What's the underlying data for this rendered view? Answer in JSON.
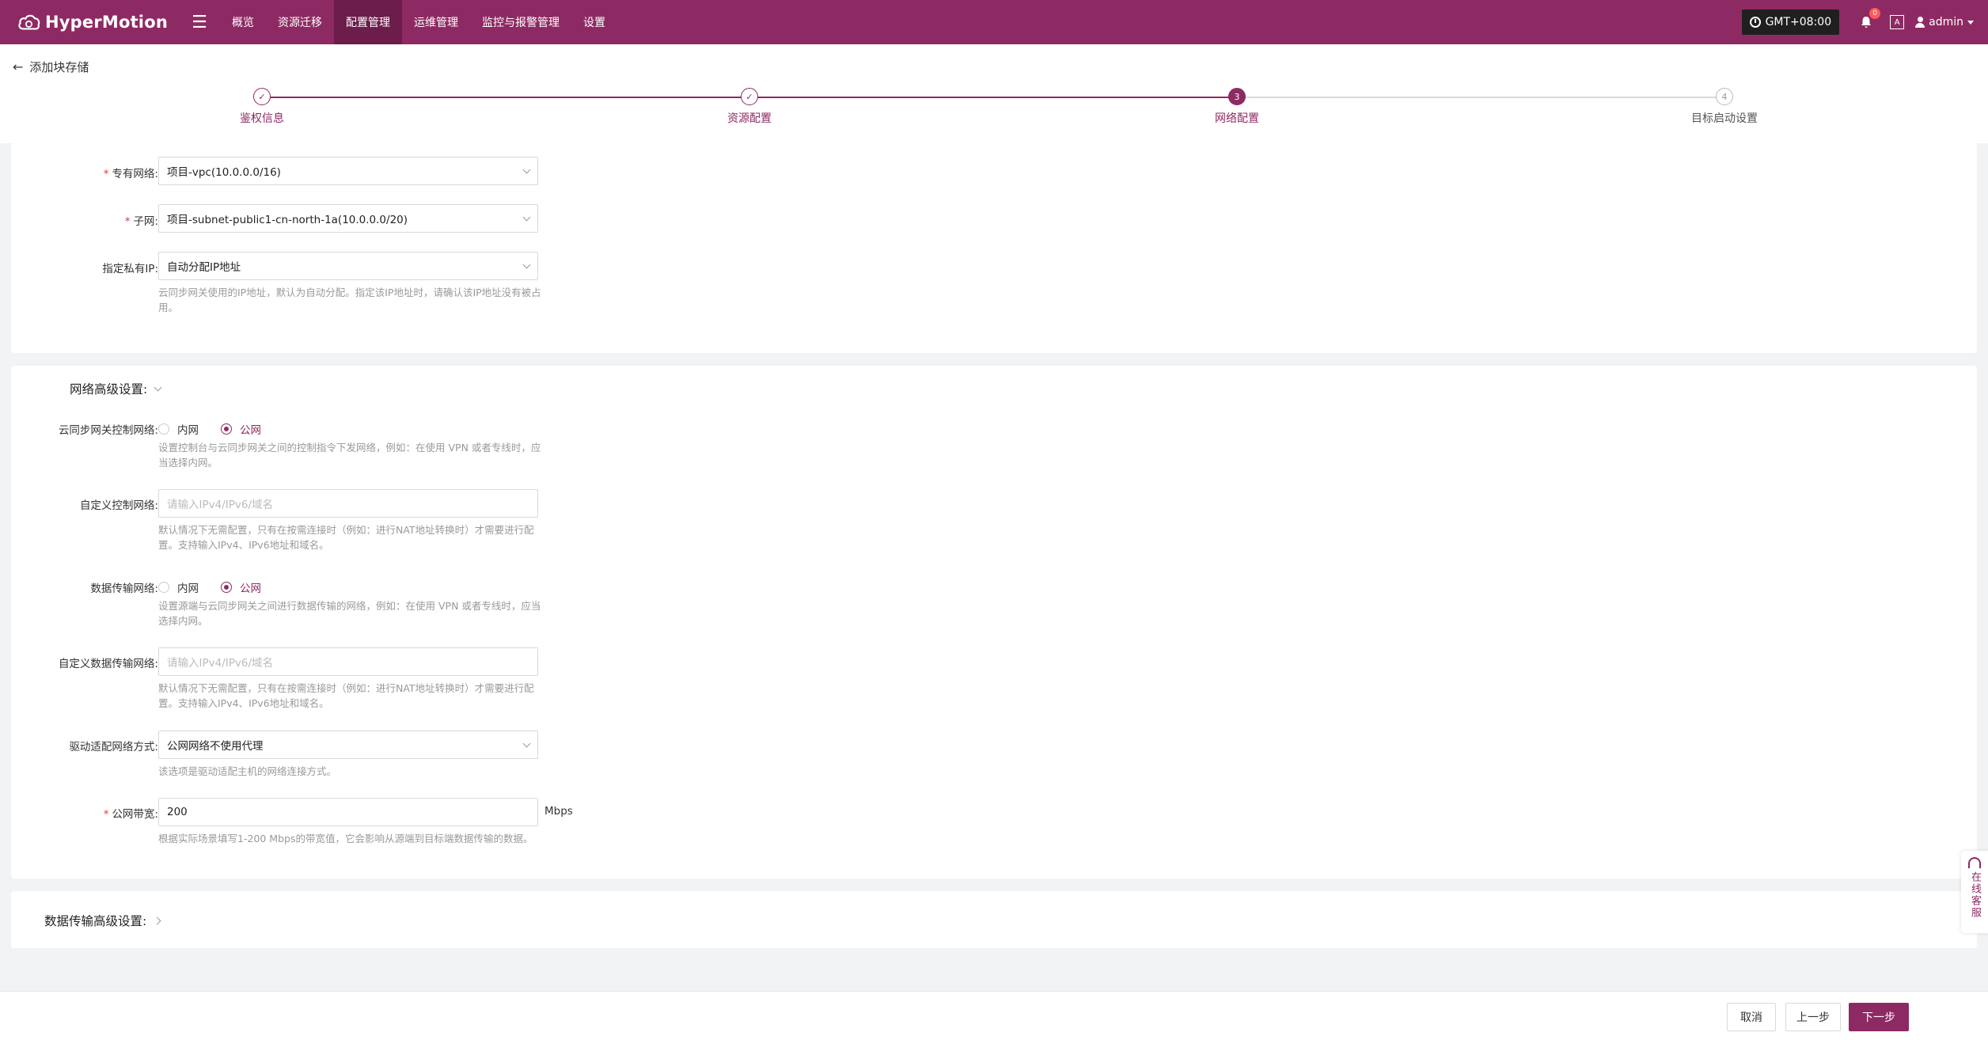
{
  "brand": {
    "name": "HyperMotion",
    "accent": "#8e2a63"
  },
  "nav": {
    "items": [
      "概览",
      "资源迁移",
      "配置管理",
      "运维管理",
      "监控与报警管理",
      "设置"
    ],
    "active_index": 2
  },
  "topbar": {
    "timezone": "GMT+08:00",
    "notifications": "0",
    "lang_icon": "A",
    "user": "admin"
  },
  "page": {
    "back_label": "添加块存储"
  },
  "steps": [
    {
      "index": "1",
      "label": "鉴权信息",
      "status": "done"
    },
    {
      "index": "2",
      "label": "资源配置",
      "status": "done"
    },
    {
      "index": "3",
      "label": "网络配置",
      "status": "current"
    },
    {
      "index": "4",
      "label": "目标启动设置",
      "status": "todo"
    }
  ],
  "network": {
    "vpc_label": "专有网络:",
    "vpc_value": "项目-vpc(10.0.0.0/16)",
    "subnet_label": "子网:",
    "subnet_value": "项目-subnet-public1-cn-north-1a(10.0.0.0/20)",
    "private_ip_label": "指定私有IP:",
    "private_ip_value": "自动分配IP地址",
    "private_ip_hint": "云同步网关使用的IP地址，默认为自动分配。指定该IP地址时，请确认该IP地址没有被占用。"
  },
  "advanced": {
    "title": "网络高级设置:",
    "control_net_label": "云同步网关控制网络:",
    "radio_internal": "内网",
    "radio_public": "公网",
    "control_net_hint": "设置控制台与云同步网关之间的控制指令下发网络，例如：在使用 VPN 或者专线时，应当选择内网。",
    "custom_control_label": "自定义控制网络:",
    "custom_placeholder": "请输入IPv4/IPv6/域名",
    "custom_hint": "默认情况下无需配置，只有在按需连接时（例如：进行NAT地址转换时）才需要进行配置。支持输入IPv4、IPv6地址和域名。",
    "data_net_label": "数据传输网络:",
    "data_net_hint": "设置源端与云同步网关之间进行数据传输的网络，例如：在使用 VPN 或者专线时，应当选择内网。",
    "custom_data_label": "自定义数据传输网络:",
    "driver_label": "驱动适配网络方式:",
    "driver_value": "公网网络不使用代理",
    "driver_hint": "该选项是驱动适配主机的网络连接方式。",
    "bandwidth_label": "公网带宽:",
    "bandwidth_value": "200",
    "bandwidth_unit": "Mbps",
    "bandwidth_hint": "根据实际场景填写1-200 Mbps的带宽值，它会影响从源端到目标端数据传输的数据。"
  },
  "data_advanced": {
    "title": "数据传输高级设置:"
  },
  "footer": {
    "cancel": "取消",
    "prev": "上一步",
    "next": "下一步"
  },
  "service": {
    "label": "在线客服"
  }
}
